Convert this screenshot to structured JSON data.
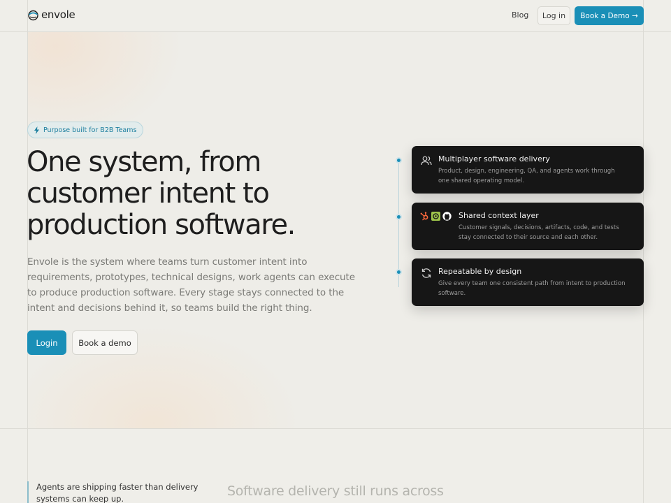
{
  "header": {
    "logo_text": "envole",
    "nav_blog": "Blog",
    "nav_login": "Log in",
    "nav_demo": "Book a Demo →"
  },
  "hero": {
    "badge": "Purpose built for B2B Teams",
    "title_lines": [
      "One system, from",
      "customer intent to",
      "production software."
    ],
    "description": "Envole is the system where teams turn customer intent into requirements, prototypes, technical designs, work agents can execute to produce production software. Every stage stays connected to the intent and decisions behind it, so teams build the right thing.",
    "login_button": "Login",
    "demo_button": "Book a demo"
  },
  "cards": [
    {
      "title": "Multiplayer software delivery",
      "description": "Product, design, engineering, QA, and agents work through one shared operating model.",
      "icon": "users-icon"
    },
    {
      "title": "Shared context layer",
      "description": "Customer signals, decisions, artifacts, code, and tests stay connected to their source and each other.",
      "icon": "integrations-logos"
    },
    {
      "title": "Repeatable by design",
      "description": "Give every team one consistent path from intent to production software.",
      "icon": "refresh-icon"
    }
  ],
  "lower": {
    "quote": "Agents are shipping faster than delivery systems can keep up.",
    "heading": "Software delivery still runs across"
  },
  "colors": {
    "accent": "#1a8fb7",
    "card_bg": "#161616",
    "page_bg": "#efeee9"
  }
}
